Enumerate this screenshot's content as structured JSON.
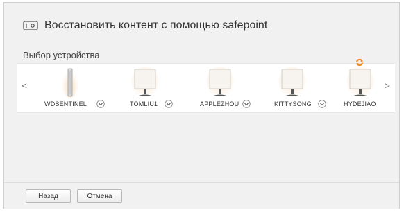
{
  "dialog": {
    "title": "Восстановить контент с помощью safepoint",
    "title_icon": "safepoint-drive-icon"
  },
  "device_selection": {
    "label": "Выбор устройства",
    "prev_icon": "<",
    "next_icon": ">",
    "devices": [
      {
        "name": "WDSENTINEL",
        "icon": "tower-server-icon",
        "dropdown_icon": "chevron-down-icon"
      },
      {
        "name": "TOMLIU1",
        "icon": "monitor-icon",
        "dropdown_icon": "chevron-down-icon"
      },
      {
        "name": "APPLEZHOU",
        "icon": "monitor-icon",
        "dropdown_icon": "chevron-down-icon"
      },
      {
        "name": "KITTYSONG",
        "icon": "monitor-icon",
        "dropdown_icon": "chevron-down-icon"
      },
      {
        "name": "HYDEJIAO",
        "icon": "monitor-icon",
        "status_icon": "sync-icon"
      }
    ]
  },
  "footer": {
    "back_label": "Назад",
    "cancel_label": "Отмена"
  },
  "colors": {
    "background": "#f1f1f1",
    "carousel": "#ffffff",
    "accent_orange": "#f08a24",
    "text": "#333333"
  }
}
